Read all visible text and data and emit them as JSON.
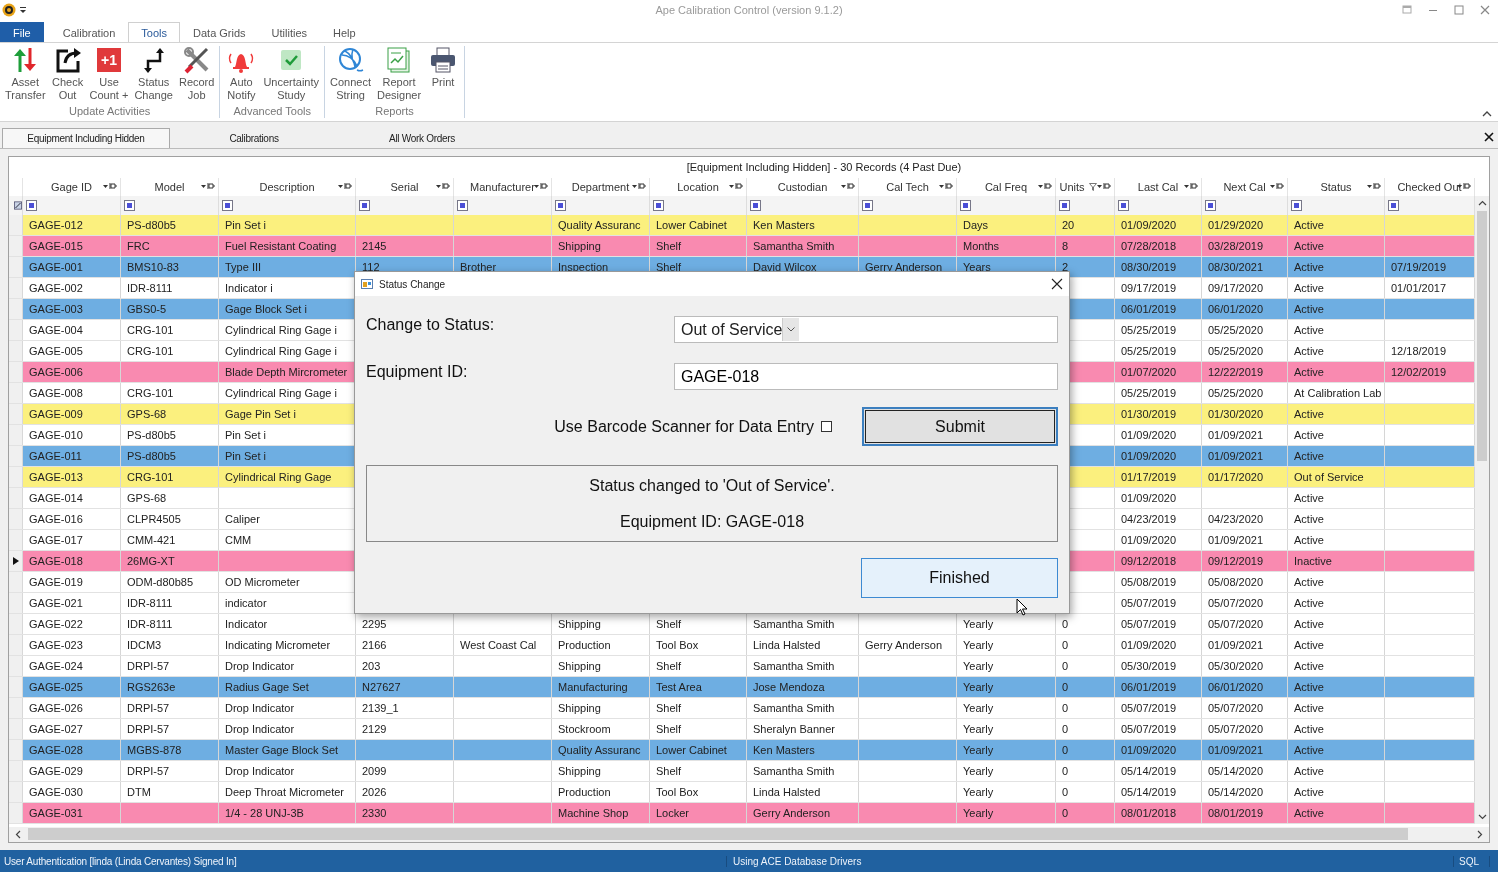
{
  "window": {
    "title": "Ape Calibration Control (version 9.1.2)"
  },
  "menu_tabs": [
    {
      "label": "File",
      "kind": "file",
      "selected": false
    },
    {
      "label": "Calibration",
      "kind": "tab",
      "selected": false
    },
    {
      "label": "Tools",
      "kind": "tab",
      "selected": true
    },
    {
      "label": "Data Grids",
      "kind": "tab",
      "selected": false
    },
    {
      "label": "Utilities",
      "kind": "tab",
      "selected": false
    },
    {
      "label": "Help",
      "kind": "tab",
      "selected": false
    }
  ],
  "ribbon": {
    "groups": [
      {
        "label": "Update Activities",
        "buttons": [
          {
            "label": "Asset\nTransfer"
          },
          {
            "label": "Check\nOut"
          },
          {
            "label": "Use\nCount +",
            "badge": "+1"
          },
          {
            "label": "Status\nChange"
          },
          {
            "label": "Record\nJob"
          }
        ]
      },
      {
        "label": "Advanced Tools",
        "buttons": [
          {
            "label": "Auto\nNotify"
          },
          {
            "label": "Uncertainty\nStudy"
          }
        ]
      },
      {
        "label": "Reports",
        "buttons": [
          {
            "label": "Connect\nString"
          },
          {
            "label": "Report\nDesigner"
          },
          {
            "label": "Print"
          }
        ]
      }
    ]
  },
  "document_tabs": [
    {
      "label": "Equipment Including Hidden",
      "selected": true
    },
    {
      "label": "Calibrations",
      "selected": false
    },
    {
      "label": "All Work Orders",
      "selected": false
    }
  ],
  "grid": {
    "caption": "[Equipment Including Hidden] - 30 Records (4 Past Due)",
    "columns": [
      {
        "label": "Gage ID",
        "filtered": false
      },
      {
        "label": "Model",
        "filtered": false
      },
      {
        "label": "Description",
        "filtered": false
      },
      {
        "label": "Serial",
        "filtered": false
      },
      {
        "label": "Manufacturer",
        "filtered": false
      },
      {
        "label": "Department",
        "filtered": false
      },
      {
        "label": "Location",
        "filtered": false
      },
      {
        "label": "Custodian",
        "filtered": false
      },
      {
        "label": "Cal Tech",
        "filtered": false
      },
      {
        "label": "Cal Freq",
        "filtered": false
      },
      {
        "label": "Units",
        "filtered": true
      },
      {
        "label": "Last Cal",
        "filtered": false
      },
      {
        "label": "Next Cal",
        "filtered": false
      },
      {
        "label": "Status",
        "filtered": false
      },
      {
        "label": "Checked Out",
        "filtered": false
      }
    ],
    "rows": [
      {
        "color": "#fbf07e",
        "current": false,
        "cells": [
          "GAGE-012",
          "PS-d80b5",
          "Pin Set i",
          null,
          null,
          "Quality Assuranc",
          "Lower Cabinet",
          "Ken Masters",
          null,
          "Days",
          "20",
          "01/09/2020",
          "01/29/2020",
          "Active",
          null
        ]
      },
      {
        "color": "#f98ab0",
        "current": false,
        "cells": [
          "GAGE-015",
          "FRC",
          "Fuel Resistant Coating",
          "2145",
          null,
          "Shipping",
          "Shelf",
          "Samantha Smith",
          null,
          "Months",
          "8",
          "07/28/2018",
          "03/28/2019",
          "Active",
          null
        ]
      },
      {
        "color": "#6eaee2",
        "current": false,
        "cells": [
          "GAGE-001",
          "BMS10-83",
          "Type III",
          "112",
          "Brother",
          "Inspection",
          "Shelf",
          "David Wilcox",
          "Gerry Anderson",
          "Years",
          "2",
          "08/30/2019",
          "08/30/2021",
          "Active",
          "07/19/2019"
        ]
      },
      {
        "color": "#ffffff",
        "current": false,
        "cells": [
          "GAGE-002",
          "IDR-8111",
          "Indicator i",
          null,
          null,
          null,
          null,
          null,
          null,
          null,
          null,
          "09/17/2019",
          "09/17/2020",
          "Active",
          "01/01/2017"
        ]
      },
      {
        "color": "#6eaee2",
        "current": false,
        "cells": [
          "GAGE-003",
          "GBS0-5",
          "Gage Block Set i",
          null,
          null,
          null,
          null,
          null,
          null,
          null,
          null,
          "06/01/2019",
          "06/01/2020",
          "Active",
          null
        ]
      },
      {
        "color": "#ffffff",
        "current": false,
        "cells": [
          "GAGE-004",
          "CRG-101",
          "Cylindrical Ring Gage i",
          null,
          null,
          null,
          null,
          null,
          null,
          null,
          null,
          "05/25/2019",
          "05/25/2020",
          "Active",
          null
        ]
      },
      {
        "color": "#ffffff",
        "current": false,
        "cells": [
          "GAGE-005",
          "CRG-101",
          "Cylindrical Ring Gage i",
          null,
          null,
          null,
          null,
          null,
          null,
          null,
          null,
          "05/25/2019",
          "05/25/2020",
          "Active",
          "12/18/2019"
        ]
      },
      {
        "color": "#f98ab0",
        "current": false,
        "cells": [
          "GAGE-006",
          null,
          "Blade Depth Mircrometer",
          null,
          null,
          null,
          null,
          null,
          null,
          null,
          null,
          "01/07/2020",
          "12/22/2019",
          "Active",
          "12/02/2019"
        ]
      },
      {
        "color": "#ffffff",
        "current": false,
        "cells": [
          "GAGE-008",
          "CRG-101",
          "Cylindrical Ring Gage i",
          null,
          null,
          null,
          null,
          null,
          null,
          null,
          null,
          "05/25/2019",
          "05/25/2020",
          "At Calibration Lab",
          null
        ]
      },
      {
        "color": "#fbf07e",
        "current": false,
        "cells": [
          "GAGE-009",
          "GPS-68",
          "Gage Pin Set i",
          null,
          null,
          null,
          null,
          null,
          null,
          null,
          null,
          "01/30/2019",
          "01/30/2020",
          "Active",
          null
        ]
      },
      {
        "color": "#ffffff",
        "current": false,
        "cells": [
          "GAGE-010",
          "PS-d80b5",
          "Pin Set i",
          null,
          null,
          null,
          null,
          null,
          null,
          null,
          null,
          "01/09/2020",
          "01/09/2021",
          "Active",
          null
        ]
      },
      {
        "color": "#6eaee2",
        "current": false,
        "cells": [
          "GAGE-011",
          "PS-d80b5",
          "Pin Set i",
          null,
          null,
          null,
          null,
          null,
          null,
          null,
          null,
          "01/09/2020",
          "01/09/2021",
          "Active",
          null
        ]
      },
      {
        "color": "#fbf07e",
        "current": false,
        "cells": [
          "GAGE-013",
          "CRG-101",
          "Cylindrical Ring Gage",
          null,
          null,
          null,
          null,
          null,
          null,
          null,
          null,
          "01/17/2019",
          "01/17/2020",
          "Out of Service",
          null
        ]
      },
      {
        "color": "#ffffff",
        "current": false,
        "cells": [
          "GAGE-014",
          "GPS-68",
          null,
          null,
          null,
          null,
          null,
          null,
          null,
          null,
          null,
          "01/09/2020",
          null,
          "Active",
          null
        ]
      },
      {
        "color": "#ffffff",
        "current": false,
        "cells": [
          "GAGE-016",
          "CLPR4505",
          "Caliper",
          null,
          null,
          null,
          null,
          null,
          null,
          null,
          null,
          "04/23/2019",
          "04/23/2020",
          "Active",
          null
        ]
      },
      {
        "color": "#ffffff",
        "current": false,
        "cells": [
          "GAGE-017",
          "CMM-421",
          "CMM",
          null,
          null,
          null,
          null,
          null,
          null,
          null,
          null,
          "01/09/2020",
          "01/09/2021",
          "Active",
          null
        ]
      },
      {
        "color": "#f98ab0",
        "current": true,
        "cells": [
          "GAGE-018",
          "26MG-XT",
          null,
          null,
          null,
          null,
          null,
          null,
          null,
          null,
          null,
          "09/12/2018",
          "09/12/2019",
          "Inactive",
          null
        ]
      },
      {
        "color": "#ffffff",
        "current": false,
        "cells": [
          "GAGE-019",
          "ODM-d80b85",
          "OD Micrometer",
          null,
          null,
          null,
          null,
          null,
          null,
          null,
          null,
          "05/08/2019",
          "05/08/2020",
          "Active",
          null
        ]
      },
      {
        "color": "#ffffff",
        "current": false,
        "cells": [
          "GAGE-021",
          "IDR-8111",
          "indicator",
          null,
          null,
          null,
          null,
          null,
          null,
          null,
          null,
          "05/07/2019",
          "05/07/2020",
          "Active",
          null
        ]
      },
      {
        "color": "#ffffff",
        "current": false,
        "cells": [
          "GAGE-022",
          "IDR-8111",
          "Indicator",
          "2295",
          null,
          "Shipping",
          "Shelf",
          "Samantha Smith",
          null,
          "Yearly",
          "0",
          "05/07/2019",
          "05/07/2020",
          "Active",
          null
        ]
      },
      {
        "color": "#ffffff",
        "current": false,
        "cells": [
          "GAGE-023",
          "IDCM3",
          "Indicating Micrometer",
          "2166",
          "West Coast Cal",
          "Production",
          "Tool Box",
          "Linda Halsted",
          "Gerry Anderson",
          "Yearly",
          "0",
          "01/09/2020",
          "01/09/2021",
          "Active",
          null
        ]
      },
      {
        "color": "#ffffff",
        "current": false,
        "cells": [
          "GAGE-024",
          "DRPI-57",
          "Drop Indicator",
          "203",
          null,
          "Shipping",
          "Shelf",
          "Samantha Smith",
          null,
          "Yearly",
          "0",
          "05/30/2019",
          "05/30/2020",
          "Active",
          null
        ]
      },
      {
        "color": "#6eaee2",
        "current": false,
        "cells": [
          "GAGE-025",
          "RGS263e",
          "Radius Gage Set",
          "N27627",
          null,
          "Manufacturing",
          "Test Area",
          "Jose Mendoza",
          null,
          "Yearly",
          "0",
          "06/01/2019",
          "06/01/2020",
          "Active",
          null
        ]
      },
      {
        "color": "#ffffff",
        "current": false,
        "cells": [
          "GAGE-026",
          "DRPI-57",
          "Drop Indicator",
          "2139_1",
          null,
          "Shipping",
          "Shelf",
          "Samantha Smith",
          null,
          "Yearly",
          "0",
          "05/07/2019",
          "05/07/2020",
          "Active",
          null
        ]
      },
      {
        "color": "#ffffff",
        "current": false,
        "cells": [
          "GAGE-027",
          "DRPI-57",
          "Drop Indicator",
          "2129",
          null,
          "Stockroom",
          "Shelf",
          "Sheralyn Banner",
          null,
          "Yearly",
          "0",
          "05/07/2019",
          "05/07/2020",
          "Active",
          null
        ]
      },
      {
        "color": "#6eaee2",
        "current": false,
        "cells": [
          "GAGE-028",
          "MGBS-878",
          "Master Gage Block Set",
          null,
          null,
          "Quality Assuranc",
          "Lower Cabinet",
          "Ken Masters",
          null,
          "Yearly",
          "0",
          "01/09/2020",
          "01/09/2021",
          "Active",
          null
        ]
      },
      {
        "color": "#ffffff",
        "current": false,
        "cells": [
          "GAGE-029",
          "DRPI-57",
          "Drop Indicator",
          "2099",
          null,
          "Shipping",
          "Shelf",
          "Samantha Smith",
          null,
          "Yearly",
          "0",
          "05/14/2019",
          "05/14/2020",
          "Active",
          null
        ]
      },
      {
        "color": "#ffffff",
        "current": false,
        "cells": [
          "GAGE-030",
          "DTM",
          "Deep Throat Micrometer",
          "2026",
          null,
          "Production",
          "Tool Box",
          "Linda Halsted",
          null,
          "Yearly",
          "0",
          "05/14/2019",
          "05/14/2020",
          "Active",
          null
        ]
      },
      {
        "color": "#f98ab0",
        "current": false,
        "cells": [
          "GAGE-031",
          null,
          "1/4 - 28 UNJ-3B",
          "2330",
          null,
          "Machine Shop",
          "Locker",
          "Gerry Anderson",
          null,
          "Yearly",
          "0",
          "08/01/2018",
          "08/01/2019",
          "Active",
          null
        ]
      }
    ]
  },
  "dialog": {
    "title": "Status Change",
    "status_label": "Change to Status:",
    "status_value": "Out of Service",
    "id_label": "Equipment ID:",
    "id_value": "GAGE-018",
    "barcode_label": "Use Barcode Scanner for Data Entry",
    "barcode_checked": false,
    "submit": "Submit",
    "result_lines": [
      "Status changed to 'Out of Service'.",
      "Equipment ID: GAGE-018"
    ],
    "finish": "Finished"
  },
  "status_bar": {
    "sections": [
      "User Authentication [linda (Linda Cervantes) Signed In]",
      "Using ACE Database Drivers",
      "SQL"
    ]
  }
}
